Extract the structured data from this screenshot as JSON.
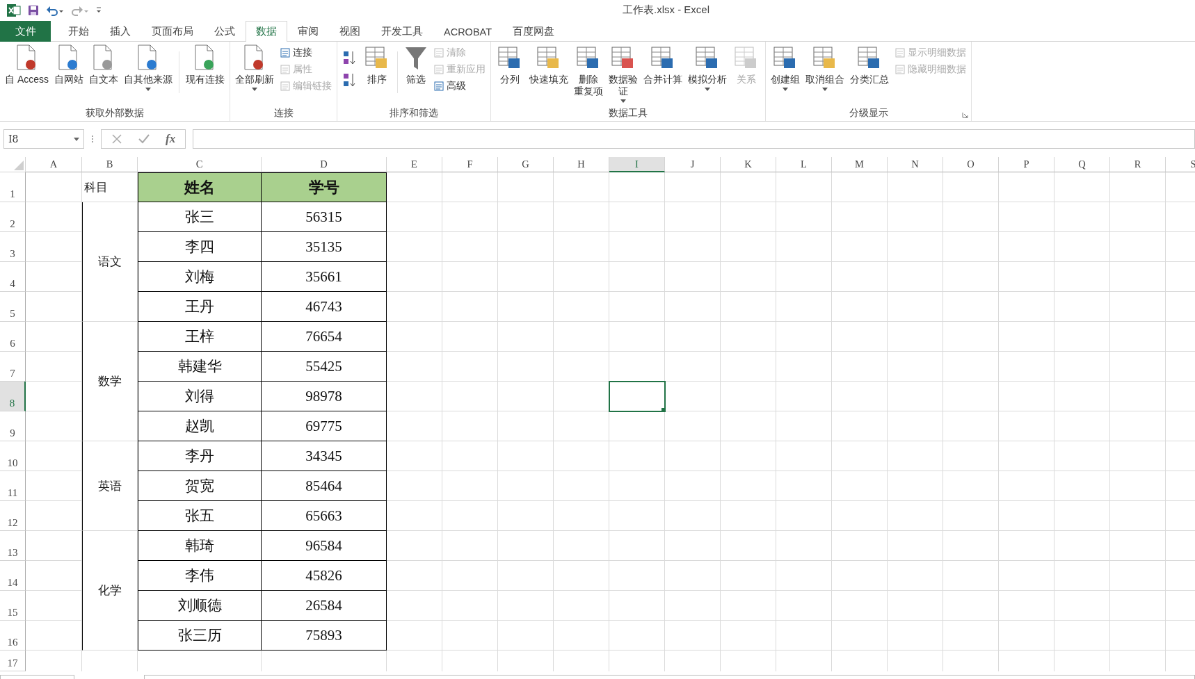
{
  "window": {
    "title": "工作表.xlsx - Excel"
  },
  "tabs": [
    {
      "label": "文件",
      "kind": "file",
      "selected": false
    },
    {
      "label": "开始",
      "kind": "tab",
      "selected": false
    },
    {
      "label": "插入",
      "kind": "tab",
      "selected": false
    },
    {
      "label": "页面布局",
      "kind": "tab",
      "selected": false
    },
    {
      "label": "公式",
      "kind": "tab",
      "selected": false
    },
    {
      "label": "数据",
      "kind": "tab",
      "selected": true
    },
    {
      "label": "审阅",
      "kind": "tab",
      "selected": false
    },
    {
      "label": "视图",
      "kind": "tab",
      "selected": false
    },
    {
      "label": "开发工具",
      "kind": "tab",
      "selected": false
    },
    {
      "label": "ACROBAT",
      "kind": "tab",
      "selected": false
    },
    {
      "label": "百度网盘",
      "kind": "tab",
      "selected": false
    }
  ],
  "ribbon": {
    "groups": [
      {
        "label": "获取外部数据",
        "dialog_launcher": false,
        "items": [
          {
            "kind": "large",
            "lines": [
              "自 Access"
            ],
            "dropdown": false,
            "disabled": false
          },
          {
            "kind": "large",
            "lines": [
              "自网站"
            ],
            "dropdown": false,
            "disabled": false
          },
          {
            "kind": "large",
            "lines": [
              "自文本"
            ],
            "dropdown": false,
            "disabled": false
          },
          {
            "kind": "large",
            "lines": [
              "自其他来源"
            ],
            "dropdown": true,
            "disabled": false
          },
          {
            "kind": "separator"
          },
          {
            "kind": "large",
            "lines": [
              "现有连接"
            ],
            "dropdown": false,
            "disabled": false
          }
        ]
      },
      {
        "label": "连接",
        "dialog_launcher": false,
        "items": [
          {
            "kind": "large",
            "lines": [
              "全部刷新"
            ],
            "dropdown": true,
            "disabled": false
          },
          {
            "kind": "stack",
            "items": [
              {
                "label": "连接",
                "disabled": false
              },
              {
                "label": "属性",
                "disabled": true
              },
              {
                "label": "编辑链接",
                "disabled": true
              }
            ]
          }
        ]
      },
      {
        "label": "排序和筛选",
        "dialog_launcher": false,
        "items": [
          {
            "kind": "sort_icons"
          },
          {
            "kind": "large",
            "lines": [
              "排序"
            ],
            "dropdown": false,
            "disabled": false
          },
          {
            "kind": "separator"
          },
          {
            "kind": "large",
            "lines": [
              "筛选"
            ],
            "dropdown": false,
            "disabled": false
          },
          {
            "kind": "stack",
            "items": [
              {
                "label": "清除",
                "disabled": true
              },
              {
                "label": "重新应用",
                "disabled": true
              },
              {
                "label": "高级",
                "disabled": false
              }
            ]
          }
        ]
      },
      {
        "label": "数据工具",
        "dialog_launcher": false,
        "items": [
          {
            "kind": "large",
            "lines": [
              "分列"
            ],
            "dropdown": false,
            "disabled": false
          },
          {
            "kind": "large",
            "lines": [
              "快速填充"
            ],
            "dropdown": false,
            "disabled": false
          },
          {
            "kind": "large",
            "lines": [
              "删除",
              "重复项"
            ],
            "dropdown": false,
            "disabled": false
          },
          {
            "kind": "large",
            "lines": [
              "数据验",
              "证"
            ],
            "dropdown": true,
            "disabled": false
          },
          {
            "kind": "large",
            "lines": [
              "合并计算"
            ],
            "dropdown": false,
            "disabled": false
          },
          {
            "kind": "large",
            "lines": [
              "模拟分析"
            ],
            "dropdown": true,
            "disabled": false
          },
          {
            "kind": "large",
            "lines": [
              "关系"
            ],
            "dropdown": false,
            "disabled": true
          }
        ]
      },
      {
        "label": "分级显示",
        "dialog_launcher": true,
        "items": [
          {
            "kind": "large",
            "lines": [
              "创建组"
            ],
            "dropdown": true,
            "disabled": false
          },
          {
            "kind": "large",
            "lines": [
              "取消组合"
            ],
            "dropdown": true,
            "disabled": false
          },
          {
            "kind": "large",
            "lines": [
              "分类汇总"
            ],
            "dropdown": false,
            "disabled": false
          },
          {
            "kind": "stack",
            "items": [
              {
                "label": "显示明细数据",
                "disabled": true
              },
              {
                "label": "隐藏明细数据",
                "disabled": true
              }
            ]
          }
        ]
      }
    ]
  },
  "formula_bar": {
    "name_box": "I8",
    "function_label": "fx"
  },
  "sheet": {
    "columns": [
      {
        "label": "A",
        "selected": false
      },
      {
        "label": "B",
        "selected": false
      },
      {
        "label": "C",
        "selected": false
      },
      {
        "label": "D",
        "selected": false
      },
      {
        "label": "E",
        "selected": false
      },
      {
        "label": "F",
        "selected": false
      },
      {
        "label": "G",
        "selected": false
      },
      {
        "label": "H",
        "selected": false
      },
      {
        "label": "I",
        "selected": true
      },
      {
        "label": "J",
        "selected": false
      },
      {
        "label": "K",
        "selected": false
      },
      {
        "label": "L",
        "selected": false
      },
      {
        "label": "M",
        "selected": false
      },
      {
        "label": "N",
        "selected": false
      },
      {
        "label": "O",
        "selected": false
      },
      {
        "label": "P",
        "selected": false
      },
      {
        "label": "Q",
        "selected": false
      },
      {
        "label": "R",
        "selected": false
      },
      {
        "label": "S",
        "selected": false
      }
    ],
    "rows": [
      {
        "label": "1",
        "selected": false
      },
      {
        "label": "2",
        "selected": false
      },
      {
        "label": "3",
        "selected": false
      },
      {
        "label": "4",
        "selected": false
      },
      {
        "label": "5",
        "selected": false
      },
      {
        "label": "6",
        "selected": false
      },
      {
        "label": "7",
        "selected": false
      },
      {
        "label": "8",
        "selected": true
      },
      {
        "label": "9",
        "selected": false
      },
      {
        "label": "10",
        "selected": false
      },
      {
        "label": "11",
        "selected": false
      },
      {
        "label": "12",
        "selected": false
      },
      {
        "label": "13",
        "selected": false
      },
      {
        "label": "14",
        "selected": false
      },
      {
        "label": "15",
        "selected": false
      },
      {
        "label": "16",
        "selected": false
      },
      {
        "label": "17",
        "selected": false
      }
    ],
    "header": {
      "subject": "科目",
      "name": "姓名",
      "id": "学号"
    },
    "groups": [
      {
        "subject": "语文",
        "students": [
          {
            "name": "张三",
            "id": "56315"
          },
          {
            "name": "李四",
            "id": "35135"
          },
          {
            "name": "刘梅",
            "id": "35661"
          },
          {
            "name": "王丹",
            "id": "46743"
          }
        ]
      },
      {
        "subject": "数学",
        "students": [
          {
            "name": "王梓",
            "id": "76654"
          },
          {
            "name": "韩建华",
            "id": "55425"
          },
          {
            "name": "刘得",
            "id": "98978"
          },
          {
            "name": "赵凯",
            "id": "69775"
          }
        ]
      },
      {
        "subject": "英语",
        "students": [
          {
            "name": "李丹",
            "id": "34345"
          },
          {
            "name": "贺宽",
            "id": "85464"
          },
          {
            "name": "张五",
            "id": "65663"
          }
        ]
      },
      {
        "subject": "化学",
        "students": [
          {
            "name": "韩琦",
            "id": "96584"
          },
          {
            "name": "李伟",
            "id": "45826"
          },
          {
            "name": "刘顺德",
            "id": "26584"
          },
          {
            "name": "张三历",
            "id": "75893"
          }
        ]
      }
    ]
  }
}
